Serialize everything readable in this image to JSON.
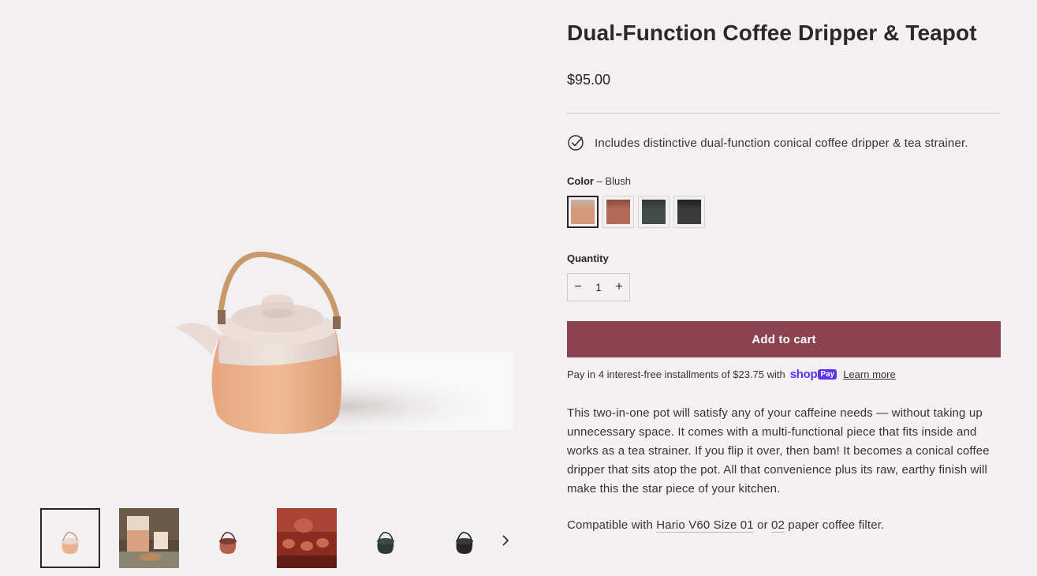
{
  "product": {
    "title": "Dual-Function Coffee Dripper & Teapot",
    "price": "$95.00",
    "feature_text": "Includes distinctive dual-function conical coffee dripper & tea strainer.",
    "feature_icon": "check-circle-icon"
  },
  "color": {
    "label": "Color",
    "separator": " – ",
    "selected": "Blush",
    "swatches": [
      {
        "name": "Blush",
        "top": "#c9b2ab",
        "bottom": "#d49a77"
      },
      {
        "name": "Terracotta",
        "top": "#8d4a3c",
        "bottom": "#b46a58"
      },
      {
        "name": "Forest",
        "top": "#2f3533",
        "bottom": "#434c49"
      },
      {
        "name": "Black",
        "top": "#1e1e1e",
        "bottom": "#3b3b3b"
      }
    ]
  },
  "quantity": {
    "label": "Quantity",
    "minus": "−",
    "plus": "+",
    "value": "1"
  },
  "cart": {
    "add_label": "Add to cart",
    "button_color": "#8c4350"
  },
  "installments": {
    "text": "Pay in 4 interest-free installments of $23.75 with",
    "shop_logo": "shop",
    "pay_badge": "Pay",
    "learn_more": "Learn more"
  },
  "description": {
    "body": "This two-in-one pot will satisfy any of your caffeine needs — without taking up unnecessary space. It comes with a multi-functional piece that fits inside and works as a tea strainer. If you flip it over, then bam! It becomes a conical coffee dripper that sits atop the pot. All that convenience plus its raw, earthy finish will make this the star piece of your kitchen.",
    "compat_prefix": "Compatible with",
    "compat_link_1": "Hario V60 Size 01",
    "compat_or": "or",
    "compat_link_2": "02",
    "compat_suffix": "paper coffee filter."
  },
  "gallery": {
    "thumbnail_count": 6,
    "active_thumbnail": 1,
    "next_icon": "chevron-right-icon"
  }
}
